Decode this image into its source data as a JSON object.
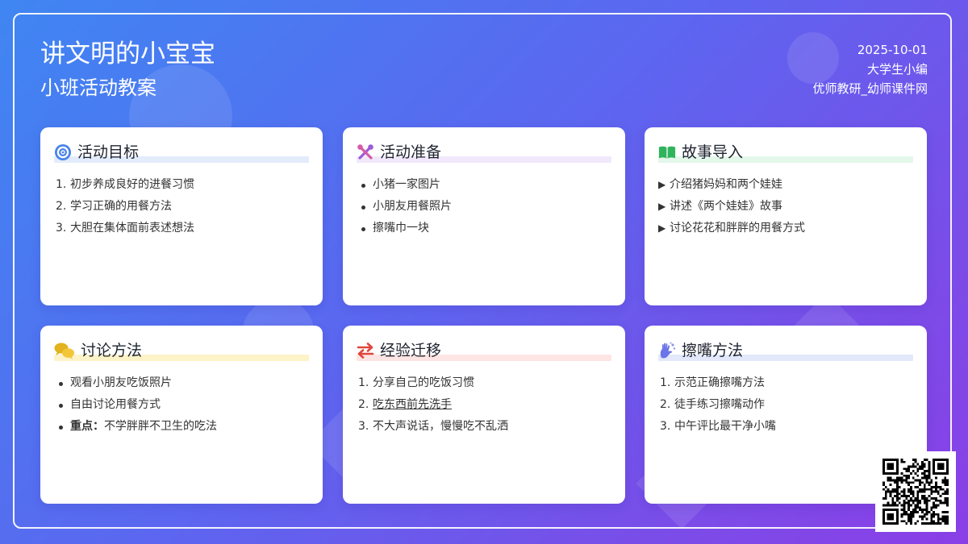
{
  "header": {
    "title": "讲文明的小宝宝",
    "subtitle": "小班活动教案",
    "date": "2025-10-01",
    "author": "大学生小编",
    "source": "优师教研_幼师课件网"
  },
  "cards": [
    {
      "title": "活动目标",
      "icon": "target-icon",
      "accent": "#e3ecfb",
      "list_style": "numbered",
      "items": [
        {
          "num": "1.",
          "text": "初步养成良好的进餐习惯"
        },
        {
          "num": "2.",
          "text": "学习正确的用餐方法"
        },
        {
          "num": "3.",
          "text": "大胆在集体面前表述想法"
        }
      ]
    },
    {
      "title": "活动准备",
      "icon": "tools-icon",
      "accent": "#f1e8fb",
      "list_style": "bullet",
      "items": [
        {
          "text": "小猪一家图片"
        },
        {
          "text": "小朋友用餐照片"
        },
        {
          "text": "擦嘴巾一块"
        }
      ]
    },
    {
      "title": "故事导入",
      "icon": "book-icon",
      "accent": "#e3f7ea",
      "list_style": "arrow",
      "items": [
        {
          "marker": "▶",
          "text": "介绍猪妈妈和两个娃娃"
        },
        {
          "marker": "▶",
          "text": "讲述《两个娃娃》故事"
        },
        {
          "marker": "▶",
          "text": "讨论花花和胖胖的用餐方式"
        }
      ]
    },
    {
      "title": "讨论方法",
      "icon": "chat-bubbles-icon",
      "accent": "#fdf3c8",
      "list_style": "bullet",
      "items": [
        {
          "text": "观看小朋友吃饭照片"
        },
        {
          "text": "自由讨论用餐方式"
        },
        {
          "strong": "重点：",
          "text": "不学胖胖不卫生的吃法"
        }
      ]
    },
    {
      "title": "经验迁移",
      "icon": "swap-arrows-icon",
      "accent": "#fde5e3",
      "list_style": "numbered",
      "items": [
        {
          "num": "1.",
          "text": "分享自己的吃饭习惯"
        },
        {
          "num": "2.",
          "text": "吃东西前先洗手",
          "underline": true
        },
        {
          "num": "3.",
          "text": "不大声说话，慢慢吃不乱洒"
        }
      ]
    },
    {
      "title": "擦嘴方法",
      "icon": "hand-wash-icon",
      "accent": "#e3e8fb",
      "list_style": "numbered",
      "items": [
        {
          "num": "1.",
          "text": "示范正确擦嘴方法"
        },
        {
          "num": "2.",
          "text": "徒手练习擦嘴动作"
        },
        {
          "num": "3.",
          "text": "中午评比最干净小嘴"
        }
      ]
    }
  ],
  "qr": {
    "icon": "qr-code-icon"
  }
}
